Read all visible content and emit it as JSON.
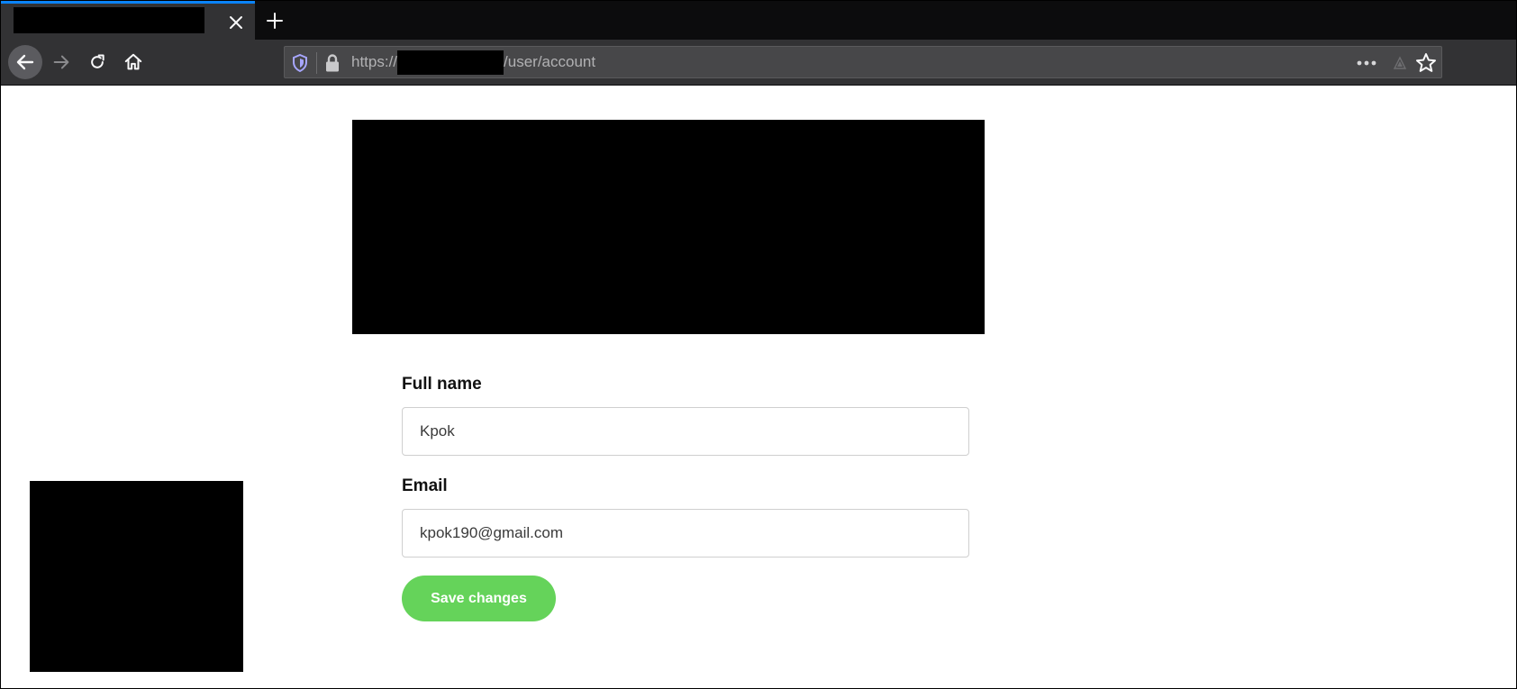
{
  "browser": {
    "tab": {
      "close_glyph": "✕"
    },
    "new_tab_glyph": "+",
    "address_bar": {
      "scheme": "https://",
      "path": "/user/account"
    },
    "icons": {
      "back": "arrow-left-icon",
      "forward": "arrow-right-icon",
      "reload": "reload-icon",
      "home": "home-icon",
      "tracking_protection": "shield-icon",
      "connection": "lock-icon",
      "page_actions": "more-dots-icon",
      "reader_view": "reader-view-icon",
      "bookmark": "star-icon"
    }
  },
  "form": {
    "full_name": {
      "label": "Full name",
      "value": "Kpok"
    },
    "email": {
      "label": "Email",
      "value": "kpok190@gmail.com"
    },
    "save_label": "Save changes"
  },
  "colors": {
    "tab_accent": "#0a84ff",
    "toolbar": "#323234",
    "tabstrip": "#0c0c0d",
    "save_button": "#65d35a"
  }
}
